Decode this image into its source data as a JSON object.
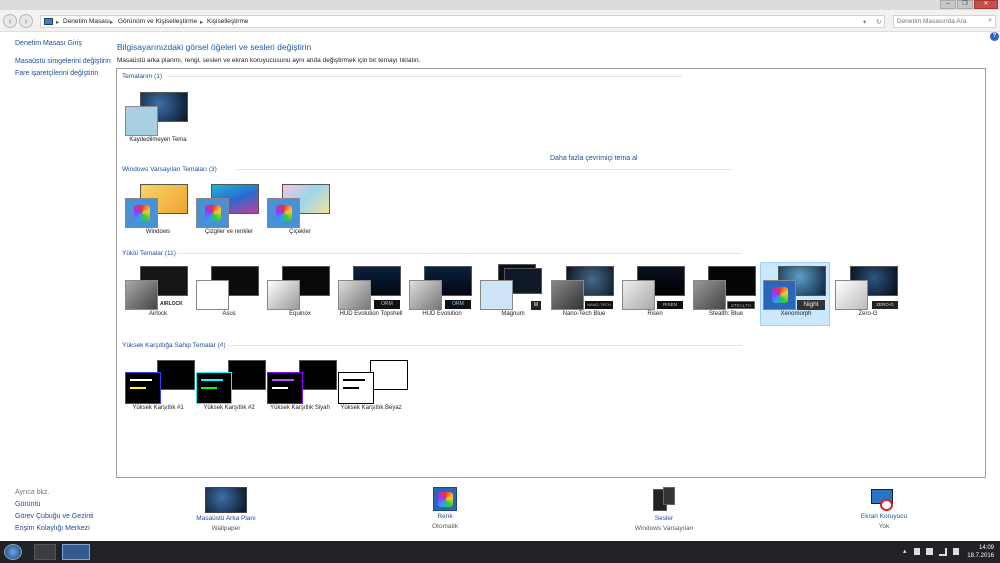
{
  "window": {
    "min": "–",
    "max": "❐",
    "close": "✕"
  },
  "address": {
    "crumbs": [
      "Denetim Masası",
      "Görünüm ve Kişiselleştirme",
      "Kişiselleştirme"
    ],
    "search_placeholder": "Denetim Masasında Ara"
  },
  "sidebar": {
    "home": "Denetim Masası Giriş",
    "links": [
      "Masaüstü simgelerini değiştirin",
      "Fare işaretçilerini değiştirin"
    ],
    "see_also_title": "Ayrıca bkz.",
    "see_also": [
      "Görüntü",
      "Görev Çubuğu ve Gezinti",
      "Erişim Kolaylığı Merkezi"
    ]
  },
  "main": {
    "heading": "Bilgisayarınızdaki görsel öğeleri ve sesleri değiştirin",
    "subtitle": "Masaüstü arka planını, rengi, sesleri ve ekran koruyucusunu aynı anda değiştirmek için bir temayı tıklatın.",
    "more_themes": "Daha fazla çevrimiçi tema al"
  },
  "sections": {
    "my": "Temalarım (1)",
    "win": "Windows Varsayılan Temaları (3)",
    "installed": "Yüklü Temalar (11)",
    "hc": "Yüksek Karşıtlığa Sahip Temalar (4)"
  },
  "themes": {
    "my": [
      {
        "name": "Kaydedilmeyen Tema"
      }
    ],
    "win": [
      {
        "name": "Windows"
      },
      {
        "name": "Çizgiler ve renkler"
      },
      {
        "name": "Çiçekler"
      }
    ],
    "installed": [
      {
        "name": "Airlock",
        "badge": "AIRLOCK"
      },
      {
        "name": "Asus",
        "badge": ""
      },
      {
        "name": "Equinox",
        "badge": ""
      },
      {
        "name": "HUD Evolution Topshell",
        "badge": "ORM"
      },
      {
        "name": "HUD Evolution",
        "badge": "ORM"
      },
      {
        "name": "Magnum",
        "badge": "M"
      },
      {
        "name": "Nano-Tech Blue",
        "badge": "NANO-TECH"
      },
      {
        "name": "Risen",
        "badge": "RISEN"
      },
      {
        "name": "Stealth: Blue",
        "badge": "STEALTH"
      },
      {
        "name": "Xenomorph",
        "badge": "Night"
      },
      {
        "name": "Zero-G",
        "badge": "ZERO-G"
      }
    ],
    "hc": [
      {
        "name": "Yüksek Karşıtlık #1"
      },
      {
        "name": "Yüksek Karşıtlık #2"
      },
      {
        "name": "Yüksek Karşıtlık Siyah"
      },
      {
        "name": "Yüksek Karşıtlık Beyaz"
      }
    ]
  },
  "bottom": [
    {
      "label": "Masaüstü Arka Planı",
      "value": "Wallpaper"
    },
    {
      "label": "Renk",
      "value": "Otomatik"
    },
    {
      "label": "Sesler",
      "value": "Windows Varsayılan"
    },
    {
      "label": "Ekran Koruyucu",
      "value": "Yok"
    }
  ],
  "clock": {
    "time": "14:09",
    "date": "18.7.2016"
  }
}
